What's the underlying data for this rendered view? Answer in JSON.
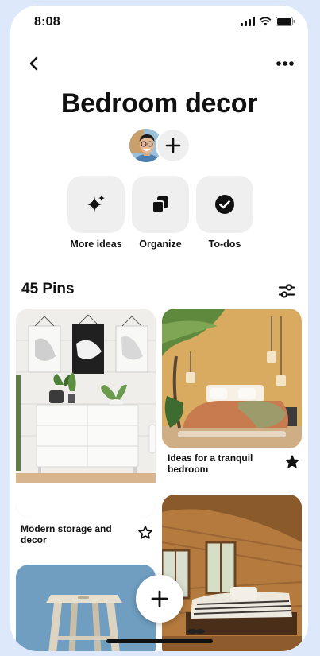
{
  "status_bar": {
    "time": "8:08"
  },
  "board": {
    "title": "Bedroom decor"
  },
  "actions": [
    {
      "label": "More ideas",
      "icon": "sparkle-icon"
    },
    {
      "label": "Organize",
      "icon": "organize-icon"
    },
    {
      "label": "To-dos",
      "icon": "checkmark-circle-icon"
    }
  ],
  "pins_header": {
    "count_label": "45 Pins"
  },
  "pins": [
    {
      "caption": "Modern storage and decor",
      "starred": false
    },
    {
      "caption": "Ideas for a tranquil bedroom",
      "starred": true
    },
    {
      "caption": "",
      "starred": false
    },
    {
      "caption": "",
      "starred": false
    }
  ],
  "colors": {
    "button_bg": "#efefef",
    "page_bg": "#dde9fb",
    "text": "#111111"
  }
}
